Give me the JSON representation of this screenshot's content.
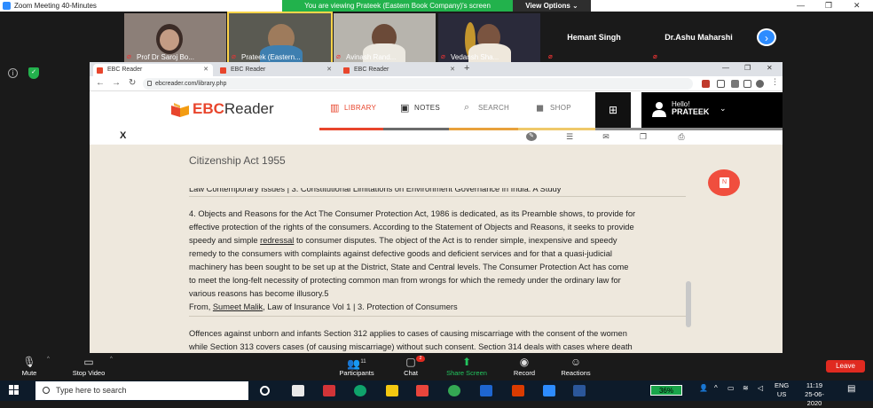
{
  "zoom": {
    "window_title": "Zoom Meeting 40-Minutes",
    "banner": "You are viewing Prateek (Eastern Book Company)'s screen",
    "view_options": "View Options ⌄",
    "participants": [
      {
        "name": "Prof Dr Saroj Bo..."
      },
      {
        "name": "Prateek (Eastern..."
      },
      {
        "name": "Avinash Rand..."
      },
      {
        "name": "Vedansh Sha..."
      }
    ],
    "name_tiles": [
      {
        "name": "Hemant Singh"
      },
      {
        "name": "Dr.Ashu Maharshi"
      }
    ],
    "toolbar": {
      "mute": "Mute",
      "stop_video": "Stop Video",
      "participants": "Participants",
      "participants_count": "11",
      "chat": "Chat",
      "chat_badge": "2",
      "share_screen": "Share Screen",
      "record": "Record",
      "reactions": "Reactions",
      "leave": "Leave"
    }
  },
  "browser": {
    "tabs": [
      "EBC Reader",
      "EBC Reader",
      "EBC Reader"
    ],
    "url": "ebcreader.com/library.php"
  },
  "ebc": {
    "logo_brand": "EBC",
    "logo_rest": "Reader",
    "nav": {
      "library": "LIBRARY",
      "notes": "NOTES",
      "search": "SEARCH",
      "shop": "SHOP"
    },
    "user": {
      "hello": "Hello!",
      "name": "PRATEEK"
    },
    "strip_colors": [
      "#e8452c",
      "#6b6b6b",
      "#e8a13c",
      "#efc96a",
      "#8b8b8b"
    ]
  },
  "reader": {
    "close": "X",
    "title": "Citizenship Act 1955",
    "float_button": "N",
    "lines": {
      "l0": "Law Contemporary Issues | 3. Constitutional Limitations on Environment Governance in India: A Study",
      "l1": "4. Objects and Reasons for the Act The Consumer Protection Act, 1986 is dedicated, as its Preamble shows, to provide for",
      "l2": "effective protection of the rights of the consumers. According to the Statement of Objects and Reasons, it seeks to provide",
      "l3a": "speedy and simple ",
      "l3b": "redressal",
      "l3c": " to consumer disputes. The object of the Act is to render simple, inexpensive and speedy",
      "l4": "remedy to the consumers with complaints against defective goods and deficient services and for that a quasi-judicial",
      "l5": "machinery has been sought to be set up at the District, State and Central levels. The Consumer Protection Act has come",
      "l6": "to meet the long-felt necessity of protecting common man from wrongs for which the remedy under the ordinary law for",
      "l7": "various reasons has become illusory.5",
      "l8a": "From, ",
      "l8b": "Sumeet Malik",
      "l8c": ", Law of Insurance Vol 1 | 3. Protection of Consumers",
      "l9": "Offences against unborn and infants Section 312 applies to cases of causing miscarriage with the consent of the women",
      "l10": "while Section 313 covers cases (of causing miscarriage) without such consent. Section 314 deals with cases where death"
    }
  },
  "taskbar": {
    "search_placeholder": "Type here to search",
    "battery": "36%",
    "lang_top": "ENG",
    "lang_bottom": "US",
    "time": "11:19",
    "date": "25-06-2020"
  }
}
